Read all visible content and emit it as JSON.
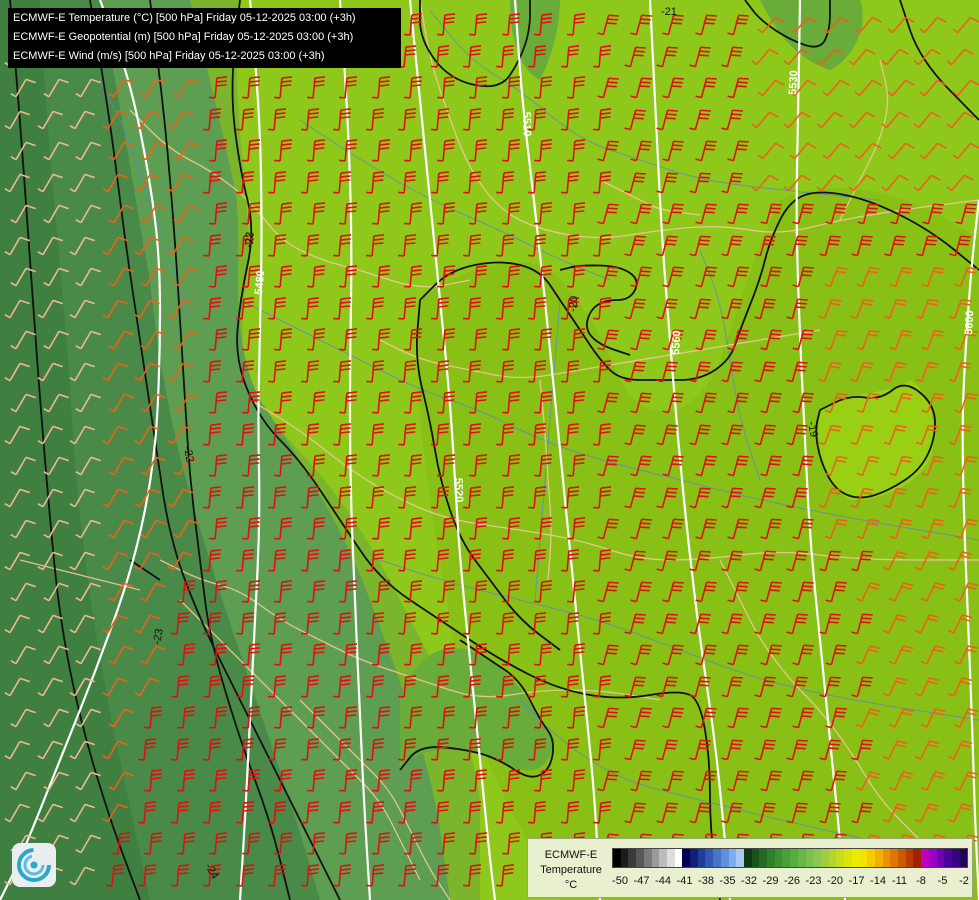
{
  "header": {
    "lines": [
      "ECMWF-E Temperature (°C) [500 hPa] Friday 05-12-2025 03:00 (+3h)",
      "ECMWF-E Geopotential (m) [500 hPa] Friday 05-12-2025 03:00 (+3h)",
      "ECMWF-E Wind (m/s) [500 hPa] Friday 05-12-2025 03:00 (+3h)"
    ]
  },
  "legend": {
    "title_line1": "ECMWF-E",
    "title_line2": "Temperature",
    "unit": "°C",
    "ticks": [
      "-50",
      "-47",
      "-44",
      "-41",
      "-38",
      "-35",
      "-32",
      "-29",
      "-26",
      "-23",
      "-20",
      "-17",
      "-14",
      "-11",
      "-8",
      "-5",
      "-2"
    ],
    "colors": [
      "#000000",
      "#1c1c1c",
      "#3a3a3a",
      "#585858",
      "#7a7a7a",
      "#9a9a9a",
      "#bcbcbc",
      "#dddddd",
      "#ffffff",
      "#000050",
      "#10207a",
      "#1e3c98",
      "#3058b4",
      "#4874c8",
      "#6090dc",
      "#80acec",
      "#a8c8f4",
      "#0c3a10",
      "#1a5418",
      "#246a20",
      "#308028",
      "#3c9030",
      "#48a038",
      "#56ac40",
      "#66b848",
      "#7ac050",
      "#8cc850",
      "#a0cc40",
      "#b4d430",
      "#c8dc20",
      "#dce410",
      "#eaec00",
      "#f2e400",
      "#f6cc00",
      "#f2b000",
      "#e89400",
      "#dc7800",
      "#cc5800",
      "#b83c00",
      "#a02000",
      "#c000c0",
      "#9800c8",
      "#7000b0",
      "#50009a",
      "#380080",
      "#24005c"
    ]
  },
  "map": {
    "temperature_labels": [
      "-22",
      "-23",
      "-24",
      "-21",
      "-20",
      "-19"
    ],
    "geopotential_labels": [
      "5480",
      "5510",
      "5520",
      "5530",
      "5560",
      "5600"
    ],
    "colors": {
      "warm_fill": "#8ec81a",
      "mid_fill": "#7ab52c",
      "cool_fill": "#5e9e52",
      "cold_fill": "#4a8a48",
      "temp_contour": "#111111",
      "geopotential_contour": "#ffffff",
      "border": "#f2c89a",
      "river": "#5a86c8",
      "wind_strong": "#e01010",
      "wind_mid": "#f06018",
      "wind_weak": "#f0b898"
    }
  }
}
